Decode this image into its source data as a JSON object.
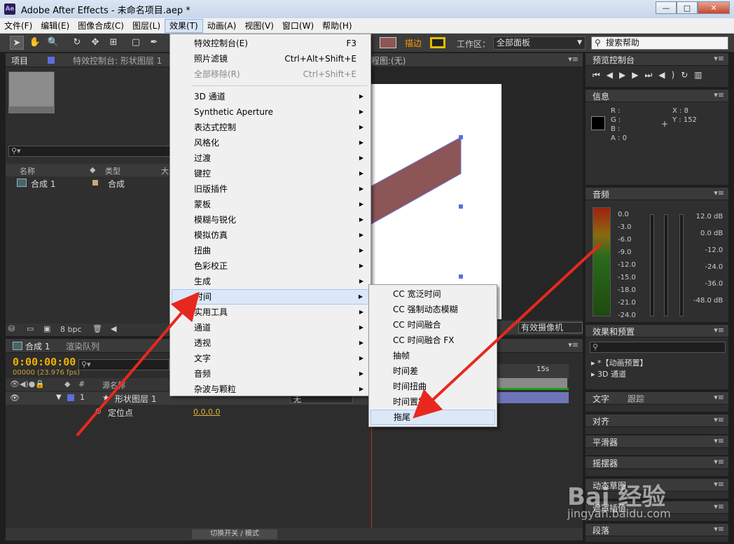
{
  "window": {
    "title": "Adobe After Effects - 未命名项目.aep *",
    "logo": "Ae",
    "controls": [
      "—",
      "□",
      "✕"
    ]
  },
  "menubar": [
    "文件(F)",
    "编辑(E)",
    "图像合成(C)",
    "图层(L)",
    "效果(T)",
    "动画(A)",
    "视图(V)",
    "窗口(W)",
    "帮助(H)"
  ],
  "toolbar": {
    "stroke_label": "描边",
    "workspace_label": "工作区：",
    "workspace_value": "全部面板",
    "help_search": "搜索帮助",
    "fill_color": "#8c5656",
    "stroke_color": "#e0c000"
  },
  "project_panel": {
    "tab": "项目",
    "effects_tab": "特效控制台: 形状图层 1",
    "col_name": "名称",
    "col_type": "类型",
    "col_size": "大",
    "item_name": "合成 1",
    "item_type": "合成",
    "bpc": "8 bpc"
  },
  "comp_panel": {
    "tab_fragment": "程图:(无)",
    "camera": "有效摄像机"
  },
  "timeline": {
    "tab": "合成 1",
    "render_tab": "渲染队列",
    "timecode": "0:00:00:00",
    "fps": "00000 (23.976 fps)",
    "col_source": "源名称",
    "layer_index": "1",
    "layer_name": "形状图层 1",
    "layer_mode": "无",
    "prop_name": "定位点",
    "prop_value": "0.0,0.0",
    "ruler_label": "15s",
    "toggle_mode": "切换开关 / 模式"
  },
  "right_panels": {
    "preview": "预览控制台",
    "info": "信息",
    "rgb": "R :\nG :\nB :\nA : 0",
    "xy": "X : 8\nY : 152",
    "audio": "音频",
    "db_left": "0.0\n-3.0\n-6.0\n-9.0\n-12.0\n-15.0\n-18.0\n-21.0\n-24.0",
    "db_right": "12.0 dB\n0.0 dB\n-12.0\n-24.0\n-36.0\n-48.0 dB",
    "effects": "效果和预置",
    "fx_item1": "▸ *【动画预置】",
    "fx_item2": "▸ 3D 通道",
    "text": "文字",
    "track": "跟踪",
    "align": "对齐",
    "smoother": "平滑器",
    "wiggler": "摇摆器",
    "motion": "动态草图",
    "mask": "遮罩插值",
    "para": "段落"
  },
  "effect_menu": {
    "top": [
      {
        "label": "特效控制台(E)",
        "shortcut": "F3",
        "disabled": false
      },
      {
        "label": "照片滤镜",
        "shortcut": "Ctrl+Alt+Shift+E",
        "disabled": false
      },
      {
        "label": "全部移除(R)",
        "shortcut": "Ctrl+Shift+E",
        "disabled": true
      }
    ],
    "categories": [
      "3D 通道",
      "Synthetic Aperture",
      "表达式控制",
      "风格化",
      "过渡",
      "键控",
      "旧版插件",
      "蒙板",
      "模糊与锐化",
      "模拟仿真",
      "扭曲",
      "色彩校正",
      "生成",
      "时间",
      "实用工具",
      "通道",
      "透视",
      "文字",
      "音频",
      "杂波与颗粒"
    ],
    "hover_index": 13
  },
  "time_submenu": [
    "CC 宽泛时间",
    "CC 强制动态模糊",
    "CC 时间融合",
    "CC 时间融合 FX",
    "抽帧",
    "时间差",
    "时间扭曲",
    "时间置换",
    "拖尾"
  ],
  "time_submenu_hover": 8,
  "watermark": {
    "brand": "Bai 经验",
    "url": "jingyan.baidu.com"
  },
  "arrow_color": "#e8281e"
}
